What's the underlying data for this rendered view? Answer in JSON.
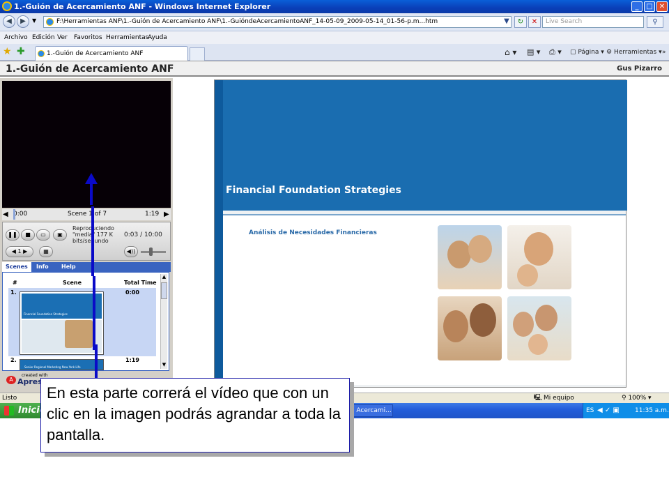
{
  "window": {
    "title": "1.-Guión de Acercamiento ANF - Windows Internet Explorer",
    "buttons": [
      "_",
      "□",
      "✕"
    ]
  },
  "address": {
    "url": "F:\\Herramientas ANF\\1.-Guión de Acercamiento ANF\\1.-GuióndeAcercamientoANF_14-05-09_2009-05-14_01-56-p.m...htm",
    "search_placeholder": "Live Search"
  },
  "menu": [
    "Archivo",
    "Edición",
    "Ver",
    "Favoritos",
    "Herramientas",
    "Ayuda"
  ],
  "tabs": {
    "active": "1.-Guión de Acercamiento ANF"
  },
  "commands": {
    "pagina": "Página",
    "herramientas": "Herramientas"
  },
  "header": {
    "title": "1.-Guión de Acercamiento ANF",
    "author": "Gus Pizarro"
  },
  "player": {
    "seek": {
      "start": "0:00",
      "scene": "Scene 1 of 7",
      "end": "1:19"
    },
    "status": "Reproduciendo \"media\" 177 K bits/segundo",
    "time": "0:03 / 10:00",
    "speed": "1"
  },
  "panel_tabs": [
    "Scenes",
    "Info",
    "Help"
  ],
  "scenes": {
    "headers": [
      "#",
      "Scene",
      "Total Time"
    ],
    "rows": [
      {
        "num": "1.",
        "time": "0:00"
      },
      {
        "num": "2.",
        "time": "1:19"
      }
    ],
    "thumb1_title": "Financial Foundation Strategies",
    "thumb2_title": "Senior Regional Marketing New York Life"
  },
  "branding": {
    "created_with": "created with",
    "logo": "Apresso"
  },
  "slide": {
    "title": "Financial Foundation Strategies",
    "subtitle": "Análisis de Necesidades Financieras"
  },
  "status": {
    "left": "Listo",
    "zone": "Mi equipo",
    "zoom": "100%"
  },
  "taskbar": {
    "start": "Inicio",
    "item": "e Acercami...",
    "lang": "ES",
    "clock": "11:35 a.m."
  },
  "callout": {
    "text": "En esta parte correrá el  vídeo que con un clic en la imagen podrás agrandar a toda la pantalla."
  }
}
